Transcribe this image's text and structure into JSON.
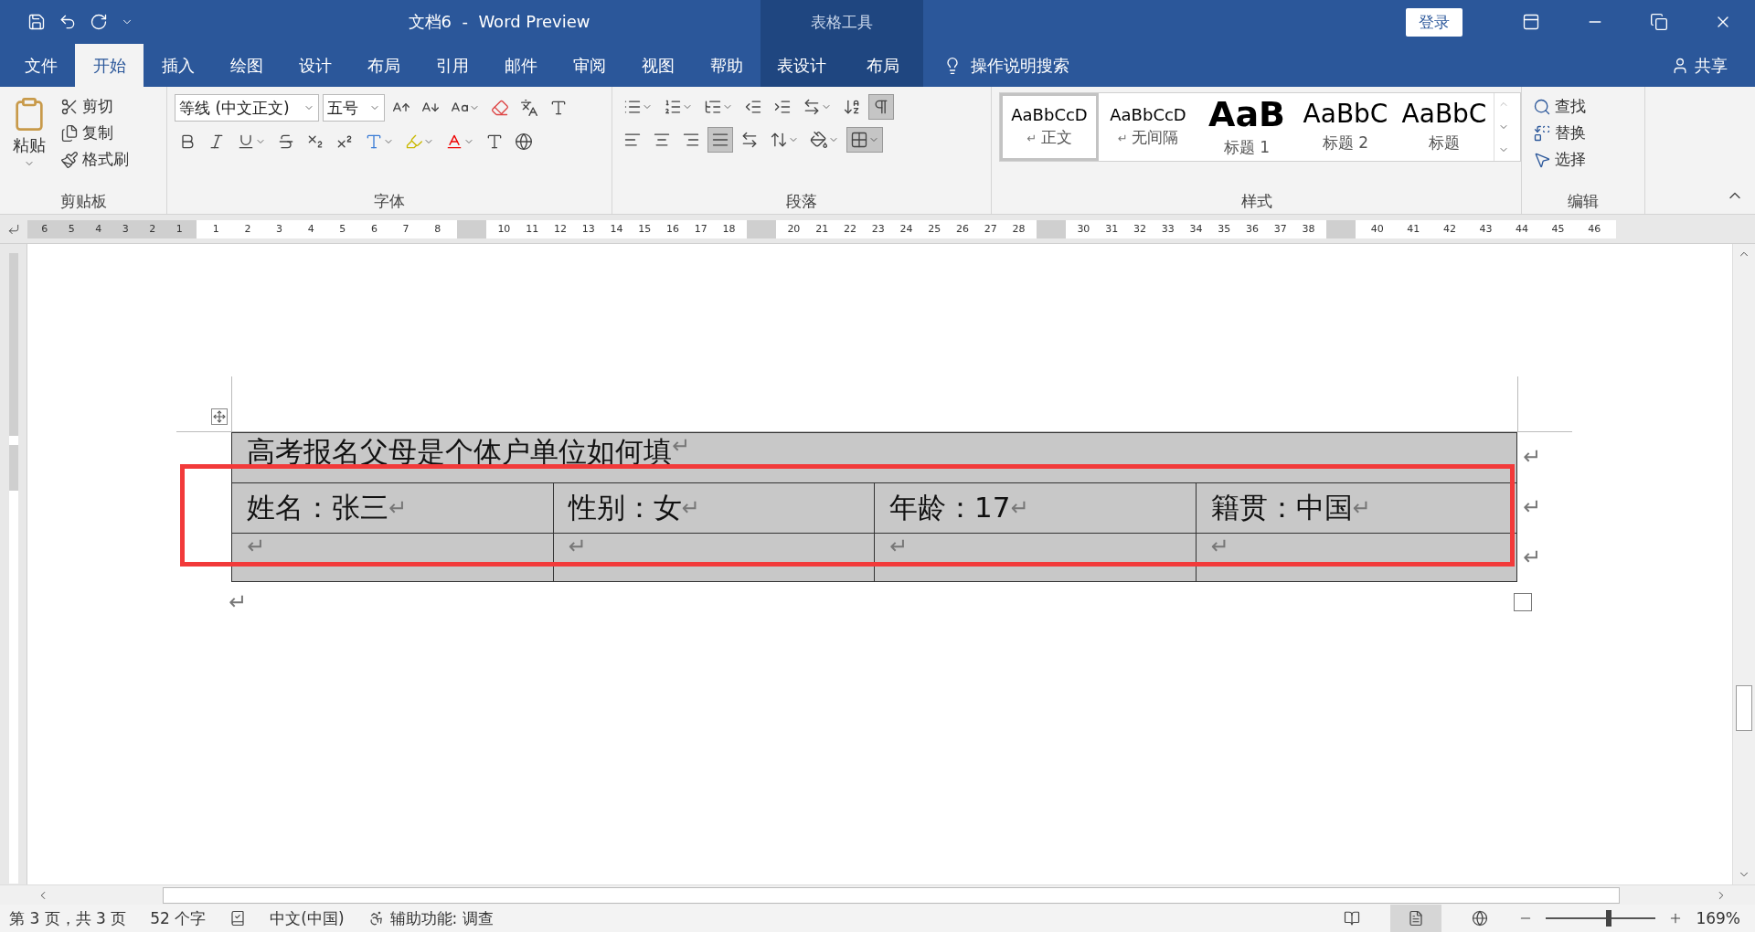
{
  "title_bar": {
    "title": "文档6  -  Word Preview",
    "context_label": "表格工具",
    "login": "登录"
  },
  "menu_tabs": [
    {
      "label": "文件",
      "selected": false,
      "contextual": false
    },
    {
      "label": "开始",
      "selected": true,
      "contextual": false
    },
    {
      "label": "插入",
      "selected": false,
      "contextual": false
    },
    {
      "label": "绘图",
      "selected": false,
      "contextual": false
    },
    {
      "label": "设计",
      "selected": false,
      "contextual": false
    },
    {
      "label": "布局",
      "selected": false,
      "contextual": false
    },
    {
      "label": "引用",
      "selected": false,
      "contextual": false
    },
    {
      "label": "邮件",
      "selected": false,
      "contextual": false
    },
    {
      "label": "审阅",
      "selected": false,
      "contextual": false
    },
    {
      "label": "视图",
      "selected": false,
      "contextual": false
    },
    {
      "label": "帮助",
      "selected": false,
      "contextual": false
    },
    {
      "label": "表设计",
      "selected": false,
      "contextual": true
    },
    {
      "label": "布局",
      "selected": false,
      "contextual": true
    }
  ],
  "tell_me": "操作说明搜索",
  "share": "共享",
  "ribbon": {
    "clipboard": {
      "paste": "粘贴",
      "items": [
        "剪切",
        "复制",
        "格式刷"
      ],
      "label": "剪贴板"
    },
    "font": {
      "font_name": "等线 (中文正文)",
      "font_size": "五号",
      "label": "字体"
    },
    "paragraph": {
      "label": "段落"
    },
    "styles": {
      "items": [
        {
          "preview": "AaBbCcD",
          "name": "正文",
          "kind": "normal",
          "selected": true,
          "mark": "↵"
        },
        {
          "preview": "AaBbCcD",
          "name": "无间隔",
          "kind": "normal",
          "selected": false,
          "mark": "↵"
        },
        {
          "preview": "AaB",
          "name": "标题 1",
          "kind": "heading1",
          "selected": false
        },
        {
          "preview": "AaBbC",
          "name": "标题 2",
          "kind": "heading2",
          "selected": false
        },
        {
          "preview": "AaBbC",
          "name": "标题",
          "kind": "title",
          "selected": false
        }
      ],
      "label": "样式"
    },
    "editing": {
      "items": [
        "查找",
        "替换",
        "选择"
      ],
      "label": "编辑"
    }
  },
  "ruler": [
    {
      "kind": "margin",
      "labels": [
        "6",
        "5",
        "4",
        "3",
        "2",
        "1"
      ]
    },
    {
      "kind": "text",
      "labels": [
        "1",
        "2",
        "3",
        "4",
        "5",
        "6",
        "7",
        "8"
      ]
    },
    {
      "kind": "gap"
    },
    {
      "kind": "text",
      "labels": [
        "10",
        "11",
        "12",
        "13",
        "14",
        "15",
        "16",
        "17",
        "18"
      ]
    },
    {
      "kind": "gap"
    },
    {
      "kind": "text",
      "labels": [
        "20",
        "21",
        "22",
        "23",
        "24",
        "25",
        "26",
        "27",
        "28"
      ]
    },
    {
      "kind": "gap"
    },
    {
      "kind": "text",
      "labels": [
        "30",
        "31",
        "32",
        "33",
        "34",
        "35",
        "36",
        "37",
        "38"
      ]
    },
    {
      "kind": "gap"
    },
    {
      "kind": "text",
      "labels": [
        "40",
        "41",
        "42",
        "43",
        "44",
        "45",
        "46"
      ]
    }
  ],
  "document": {
    "table": {
      "title": {
        "text": "高考报名父母是个体户单位如何填",
        "mark": "↵",
        "end_mark": "↵"
      },
      "rows": [
        {
          "cells": [
            {
              "text": "姓名：张三",
              "mark": "↵"
            },
            {
              "text": "性别：女",
              "mark": "↵"
            },
            {
              "text": "年龄：17",
              "mark": "↵"
            },
            {
              "text": "籍贯：中国",
              "mark": "↵"
            }
          ],
          "end_mark": "↵"
        },
        {
          "cells": [
            {
              "mark": "↵"
            },
            {
              "mark": "↵"
            },
            {
              "mark": "↵"
            },
            {
              "mark": "↵"
            }
          ],
          "end_mark": "↵"
        }
      ]
    },
    "after_mark": "↵"
  },
  "status_bar": {
    "page": "第 3 页，共 3 页",
    "words": "52 个字",
    "language": "中文(中国)",
    "accessibility": "辅助功能: 调查",
    "zoom": {
      "label": "169%",
      "level": 0.575
    }
  }
}
